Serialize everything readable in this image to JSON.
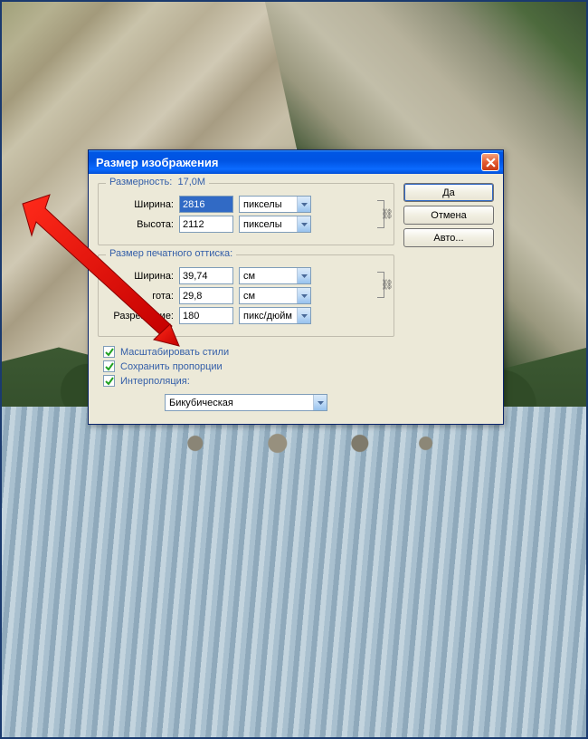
{
  "dialog": {
    "title": "Размер изображения",
    "pixel_group": {
      "legend": "Размерность:",
      "size_readout": "17,0M",
      "width_label": "Ширина:",
      "width_value": "2816",
      "width_unit": "пикселы",
      "height_label": "Высота:",
      "height_value": "2112",
      "height_unit": "пикселы"
    },
    "print_group": {
      "legend": "Размер печатного оттиска:",
      "width_label": "Ширина:",
      "width_value": "39,74",
      "width_unit": "см",
      "height_label": "гота:",
      "height_value": "29,8",
      "height_unit": "см",
      "res_label": "Разрешение:",
      "res_value": "180",
      "res_unit": "пикс/дюйм"
    },
    "checks": {
      "scale_styles": "Масштабировать стили",
      "constrain": "Сохранить пропорции",
      "resample": "Интерполяция:"
    },
    "interp_method": "Бикубическая",
    "buttons": {
      "ok": "Да",
      "cancel": "Отмена",
      "auto": "Авто..."
    }
  }
}
